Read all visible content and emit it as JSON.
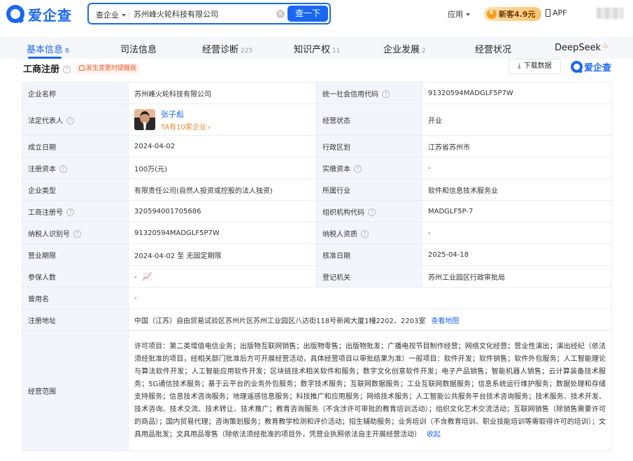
{
  "header": {
    "brand": "爱企查",
    "search_type": "查企业",
    "search_value": "苏州峰火轮科技有限公司",
    "search_button": "查一下",
    "app_menu": "应用",
    "promo": "新客4.9元",
    "app_download": "APF"
  },
  "tabs": [
    {
      "label": "基本信息",
      "count": "8",
      "active": true
    },
    {
      "label": "司法信息",
      "count": ""
    },
    {
      "label": "经营诊断",
      "count": "225"
    },
    {
      "label": "知识产权",
      "count": "11"
    },
    {
      "label": "企业发展",
      "count": "2"
    },
    {
      "label": "经营状况",
      "count": ""
    },
    {
      "label": "DeepSeek",
      "count": ""
    }
  ],
  "section": {
    "title": "工商注册",
    "alert": "发生变更时提醒我",
    "download": "下载数据",
    "brand": "爱企查"
  },
  "info": {
    "company_name_label": "企业名称",
    "company_name": "苏州峰火轮科技有限公司",
    "credit_code_label": "统一社会信用代码",
    "credit_code": "91320594MADGLF5P7W",
    "legal_rep_label": "法定代表人",
    "legal_rep_name": "张子彪",
    "legal_rep_sub": "TA有10家企业",
    "status_label": "经营状态",
    "status": "开业",
    "founded_label": "成立日期",
    "founded": "2024-04-02",
    "region_label": "行政区划",
    "region": "江苏省苏州市",
    "reg_capital_label": "注册资本",
    "reg_capital": "100万(元)",
    "paid_capital_label": "实缴资本",
    "paid_capital": "-",
    "type_label": "企业类型",
    "type": "有限责任公司(自然人投资或控股的法人独资)",
    "industry_label": "所属行业",
    "industry": "软件和信息技术服务业",
    "reg_no_label": "工商注册号",
    "reg_no": "320594001705686",
    "org_code_label": "组织机构代码",
    "org_code": "MADGLF5P-7",
    "tax_id_label": "纳税人识别号",
    "tax_id": "91320594MADGLF5P7W",
    "tax_qual_label": "纳税人资质",
    "tax_qual": "-",
    "term_label": "营业期限",
    "term": "2024-04-02 至 无固定期限",
    "approved_label": "核准日期",
    "approved": "2025-04-18",
    "insured_label": "参保人数",
    "insured": "-",
    "authority_label": "登记机关",
    "authority": "苏州工业园区行政审批局",
    "former_name_label": "曾用名",
    "former_name": "-",
    "address_label": "注册地址",
    "address": "中国（江苏）自由贸易试验区苏州片区苏州工业园区八达街118号新闻大厦1幢2202、2203室",
    "map_link": "查看地图",
    "scope_label": "经营范围",
    "scope": "许可项目：第二类增值电信业务；出版物互联网销售；出版物零售；出版物批发；广播电视节目制作经营；网络文化经营；营业性演出；演出经纪（依法须经批准的项目，经相关部门批准后方可开展经营活动，具体经营项目以审批结果为准）一般项目：软件开发；软件销售；软件外包服务；人工智能理论与算法软件开发；人工智能应用软件开发；区块链技术相关软件和服务；数字文化创意软件开发；电子产品销售；智能机器人销售；云计算装备技术服务；5G通信技术服务；基于云平台的业务外包服务；数字技术服务；互联网数据服务；工业互联网数据服务；信息系统运行维护服务；数据处理和存储支持服务；信息技术咨询服务；地理遥感信息服务；科技推广和应用服务；网络技术服务；人工智能公共服务平台技术咨询服务；技术服务、技术开发、技术咨询、技术交流、技术转让、技术推广；教育咨询服务（不含涉许可审批的教育培训活动）；组织文化艺术交流活动；互联网销售（除销售需要许可的商品）；国内贸易代理；咨询策划服务；教育教学检测和评价活动；招生辅助服务；业务培训（不含教育培训、职业技能培训等需取得许可的培训）；文具用品批发；文具用品零售（除依法须经批准的项目外，凭营业执照依法自主开展经营活动）",
    "collapse": "收起"
  }
}
